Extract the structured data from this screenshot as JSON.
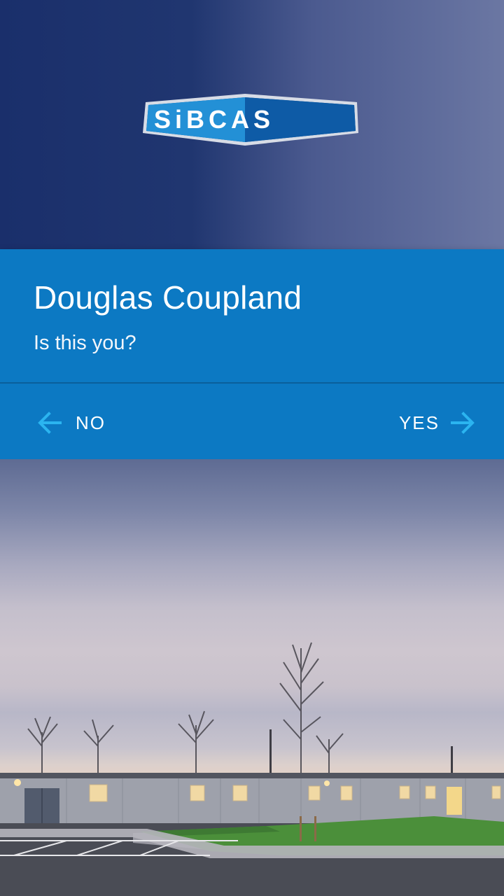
{
  "brand": {
    "logo_text": "SiBCAS",
    "logo_colors": {
      "outer": "#1a3d86",
      "inner_light": "#1f8ad0",
      "inner_dark": "#0b4e93",
      "border": "#cfd6e2"
    }
  },
  "card": {
    "name": "Douglas Coupland",
    "question": "Is this you?",
    "background": "#0c79c3"
  },
  "actions": {
    "no_label": "NO",
    "yes_label": "YES",
    "no_icon": "arrow-left-icon",
    "yes_icon": "arrow-right-icon",
    "icon_color": "#2bb4f0"
  }
}
